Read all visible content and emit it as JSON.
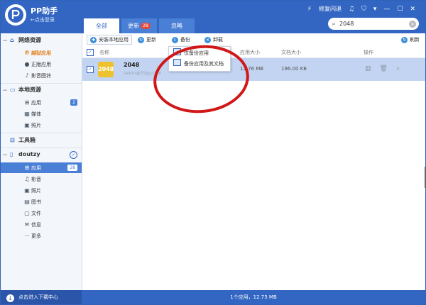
{
  "app": {
    "title": "PP助手",
    "login_link": "←点击登录"
  },
  "header": {
    "tabs": [
      {
        "label": "全部",
        "badge": ""
      },
      {
        "label": "更新",
        "badge": "28"
      },
      {
        "label": "忽略",
        "badge": ""
      }
    ],
    "flash_label": "修复闪退",
    "search": {
      "value": "2048"
    }
  },
  "sidebar": {
    "network": {
      "label": "网络资源",
      "items": [
        {
          "label": "越狱应用"
        },
        {
          "label": "正版应用"
        },
        {
          "label": "影音图铃"
        }
      ]
    },
    "local": {
      "label": "本地资源",
      "items": [
        {
          "label": "应用",
          "count": "2"
        },
        {
          "label": "媒体"
        },
        {
          "label": "照片"
        }
      ]
    },
    "toolbox": {
      "label": "工具箱"
    },
    "device": {
      "label": "doutzy",
      "items": [
        {
          "label": "应用",
          "count": "28"
        },
        {
          "label": "影音"
        },
        {
          "label": "照片"
        },
        {
          "label": "图书"
        },
        {
          "label": "文件"
        },
        {
          "label": "信息"
        },
        {
          "label": "更多"
        }
      ]
    }
  },
  "toolbar": {
    "install_label": "安装本地应用",
    "update_label": "更新",
    "backup_label": "备份",
    "delete_label": "卸载",
    "refresh_label": "刷新"
  },
  "table": {
    "columns": {
      "name": "名称",
      "app_size": "应用大小",
      "doc_size": "文档大小",
      "actions": "操作"
    },
    "rows": [
      {
        "icon_text": "2048",
        "name": "2048",
        "subtitle": "tairon@25pp.com",
        "app_size": "12.76 MB",
        "doc_size": "196.00 KB"
      }
    ]
  },
  "backup_menu": {
    "items": [
      {
        "label": "仅备份应用"
      },
      {
        "label": "备份应用及其文档"
      }
    ]
  },
  "footer": {
    "download_center": "点击进入下载中心",
    "status": "1个应用，12.75 MB"
  },
  "colors": {
    "header_blue": "#3366c2",
    "selected_blue": "#4a7fd6",
    "row_highlight": "#c2d4f1",
    "badge_red": "#e24a3b",
    "jailbreak_orange": "#e0821e",
    "annotation_red": "#d11818"
  }
}
